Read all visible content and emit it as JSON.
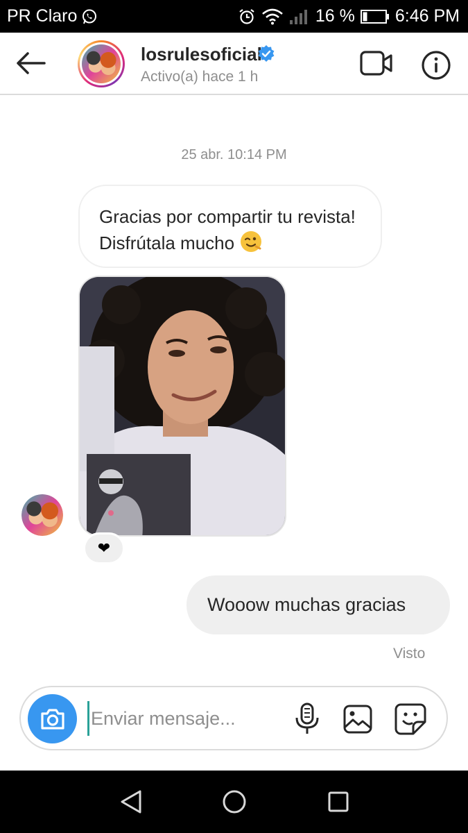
{
  "status_bar": {
    "carrier": "PR Claro",
    "battery": "16 %",
    "time": "6:46 PM",
    "icons": [
      "whatsapp-icon",
      "alarm-icon",
      "wifi-icon",
      "signal-icon",
      "battery-icon"
    ]
  },
  "header": {
    "username": "losrulesoficial",
    "activity": "Activo(a) hace 1 h",
    "icons": [
      "back-arrow-icon",
      "verified-badge-icon",
      "video-call-icon",
      "info-icon"
    ]
  },
  "conversation": {
    "timestamp": "25 abr. 10:14 PM",
    "incoming_text": "Gracias por compartir tu revista! Disfrútala mucho",
    "incoming_emoji": "winking-face-emoji",
    "photo_reaction": "❤",
    "outgoing_text": "Wooow muchas gracias",
    "seen_label": "Visto"
  },
  "composer": {
    "placeholder": "Enviar mensaje...",
    "icons": [
      "camera-icon",
      "microphone-icon",
      "gallery-icon",
      "sticker-icon"
    ]
  },
  "nav_bar": {
    "icons": [
      "back-triangle-icon",
      "home-circle-icon",
      "recents-square-icon"
    ]
  },
  "colors": {
    "accent_blue": "#3897f0",
    "verified_blue": "#3897f0",
    "bubble_grey": "#efefef",
    "muted_text": "#8e8e8e"
  }
}
